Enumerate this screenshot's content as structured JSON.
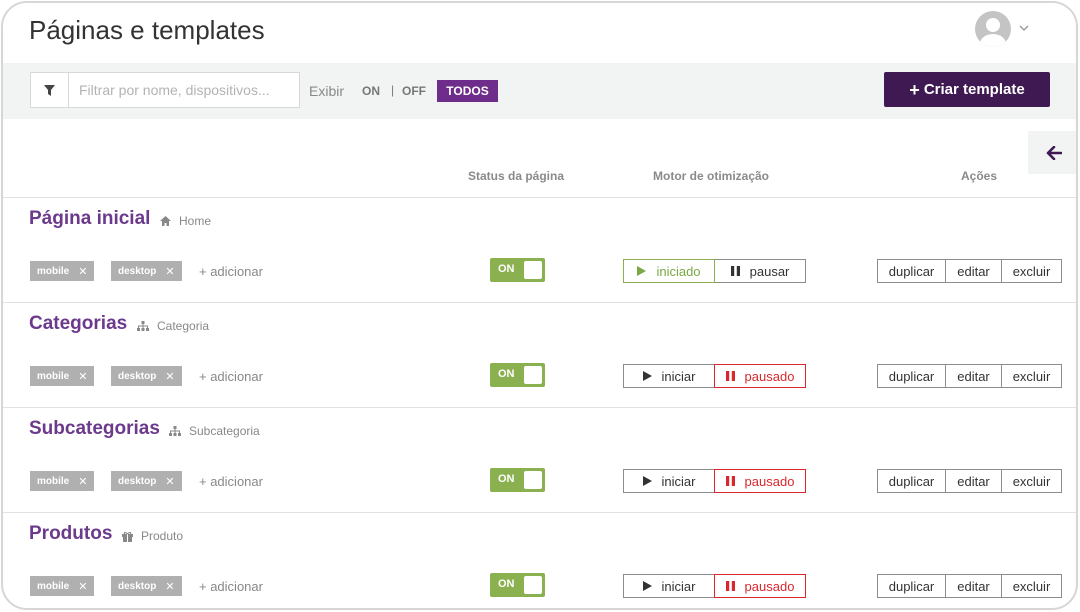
{
  "header": {
    "title": "Páginas e templates"
  },
  "toolbar": {
    "filter_placeholder": "Filtrar por nome, dispositivos...",
    "show_label": "Exibir",
    "option_on": "ON",
    "separator": "|",
    "option_off": "OFF",
    "option_all": "TODOS",
    "selected_option": "TODOS",
    "create_label": "Criar template",
    "create_plus": "+"
  },
  "columns": {
    "status": "Status da página",
    "motor": "Motor de otimização",
    "actions": "Ações"
  },
  "rows": [
    {
      "title": "Página inicial",
      "type": "Home",
      "type_icon": "home-icon",
      "tags": [
        "mobile",
        "desktop"
      ],
      "add_label": "+ adicionar",
      "status": "ON",
      "motor_start": "iniciado",
      "motor_pause": "pausar",
      "motor_state": "running",
      "actions": {
        "duplicate": "duplicar",
        "edit": "editar",
        "delete": "excluir"
      }
    },
    {
      "title": "Categorias",
      "type": "Categoria",
      "type_icon": "sitemap-icon",
      "tags": [
        "mobile",
        "desktop"
      ],
      "add_label": "+ adicionar",
      "status": "ON",
      "motor_start": "iniciar",
      "motor_pause": "pausado",
      "motor_state": "paused",
      "actions": {
        "duplicate": "duplicar",
        "edit": "editar",
        "delete": "excluir"
      }
    },
    {
      "title": "Subcategorias",
      "type": "Subcategoria",
      "type_icon": "sitemap-icon",
      "tags": [
        "mobile",
        "desktop"
      ],
      "add_label": "+ adicionar",
      "status": "ON",
      "motor_start": "iniciar",
      "motor_pause": "pausado",
      "motor_state": "paused",
      "actions": {
        "duplicate": "duplicar",
        "edit": "editar",
        "delete": "excluir"
      }
    },
    {
      "title": "Produtos",
      "type": "Produto",
      "type_icon": "gift-icon",
      "tags": [
        "mobile",
        "desktop"
      ],
      "add_label": "+ adicionar",
      "status": "ON",
      "motor_start": "iniciar",
      "motor_pause": "pausado",
      "motor_state": "paused",
      "actions": {
        "duplicate": "duplicar",
        "edit": "editar",
        "delete": "excluir"
      }
    }
  ],
  "colors": {
    "accent_purple": "#6b3a8c",
    "todos_bg": "#6f2d8b",
    "create_bg": "#3f1a52",
    "toggle_green": "#8ab04f",
    "paused_red": "#d8282e"
  }
}
